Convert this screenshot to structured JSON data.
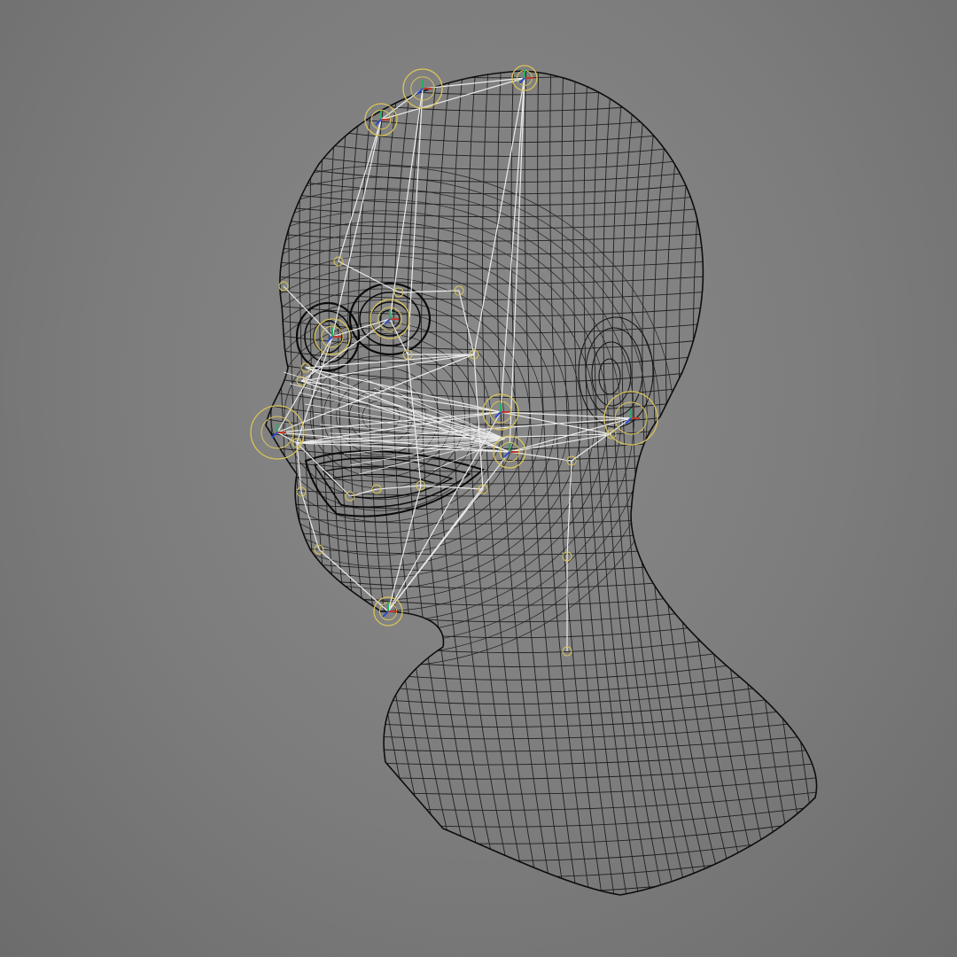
{
  "viewport": {
    "background_color": "#7f7f7f",
    "mesh_color": "#101010",
    "rig_color": "#f2f2f2",
    "joint_color": "#d8c35a",
    "axis_colors": {
      "x": "#c0392b",
      "y": "#27ae60",
      "z": "#2e4cc9"
    }
  }
}
